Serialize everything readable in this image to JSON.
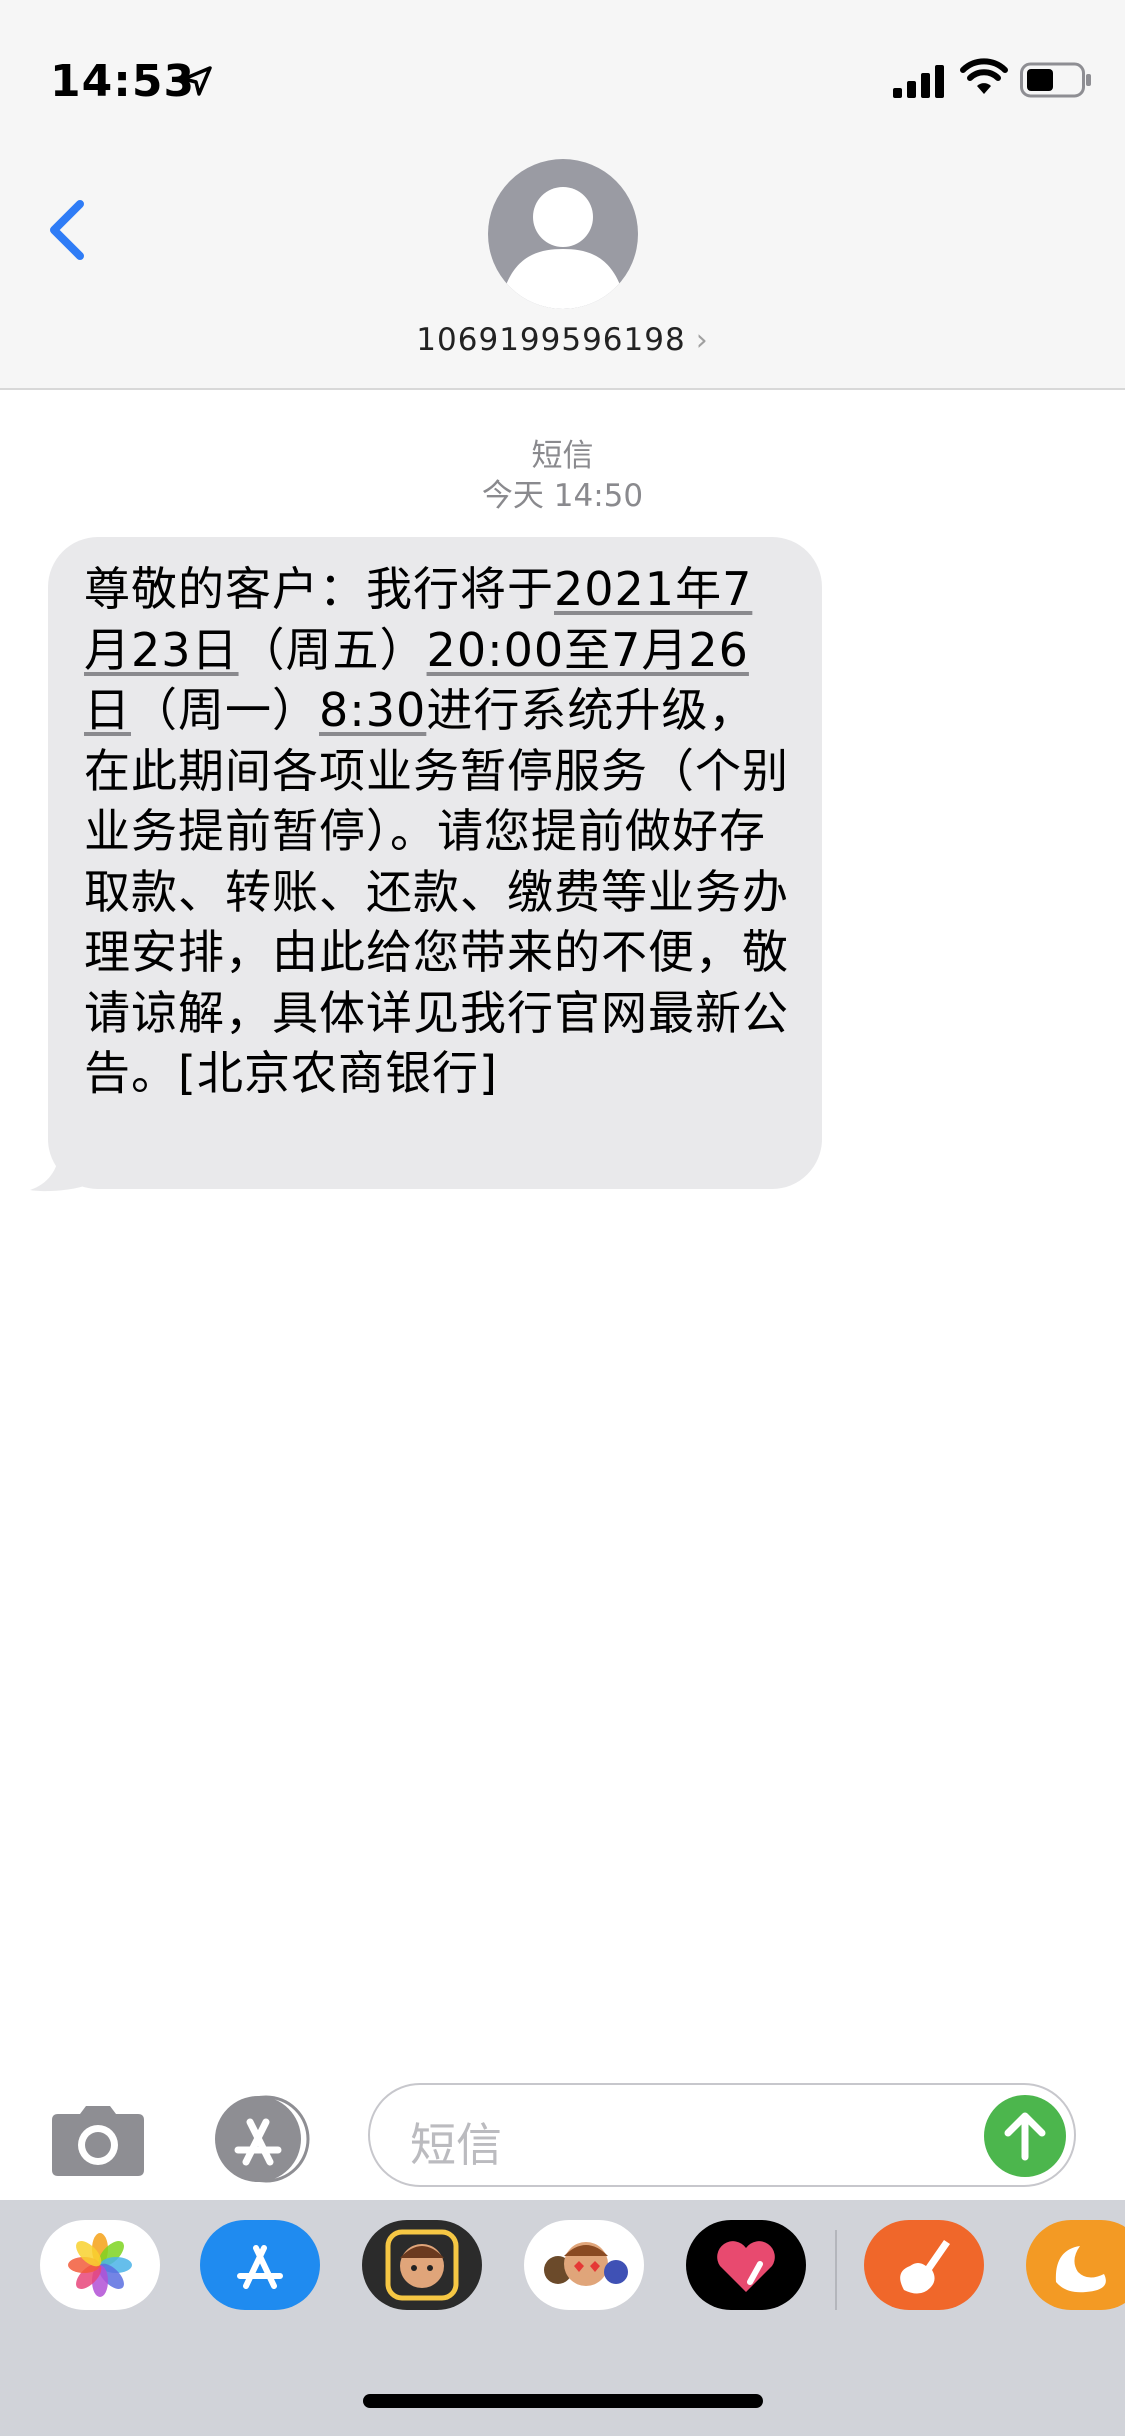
{
  "status_bar": {
    "time": "14:53",
    "icons": [
      "location-arrow-icon",
      "cellular-signal-icon",
      "wifi-icon",
      "battery-icon"
    ]
  },
  "header": {
    "back_icon": "chevron-left-icon",
    "avatar_icon": "person-silhouette-icon",
    "contact": "1069199596198",
    "contact_chevron": "›"
  },
  "thread": {
    "message_type": "短信",
    "timestamp": "今天 14:50",
    "message": {
      "parts": [
        "尊敬的客户：我行将于",
        "2021年7月23日",
        "（周五）",
        "20:00至7月26日",
        "（周一）",
        "8:30",
        "进行系统升级，在此期间各项业务暂停服务（个别业务提前暂停）。请您提前做好存取款、转账、还款、缴费等业务办理安排，由此给您带来的不便，敬请谅解，具体详见我行官网最新公告。[北京农商银行]"
      ]
    }
  },
  "composer": {
    "camera_icon": "camera-icon",
    "apps_icon": "app-store-icon",
    "placeholder": "短信",
    "send_icon": "arrow-up-icon",
    "send_color": "#4cb64d"
  },
  "app_drawer": {
    "apps": [
      "photos-icon",
      "app-store-icon",
      "memoji-icon",
      "animoji-stickers-icon",
      "digital-touch-icon",
      "garageband-icon",
      "uc-browser-icon"
    ]
  },
  "colors": {
    "accent": "#2f7cf6",
    "bubble": "#e9e9eb",
    "header_bg": "#f6f6f6"
  }
}
